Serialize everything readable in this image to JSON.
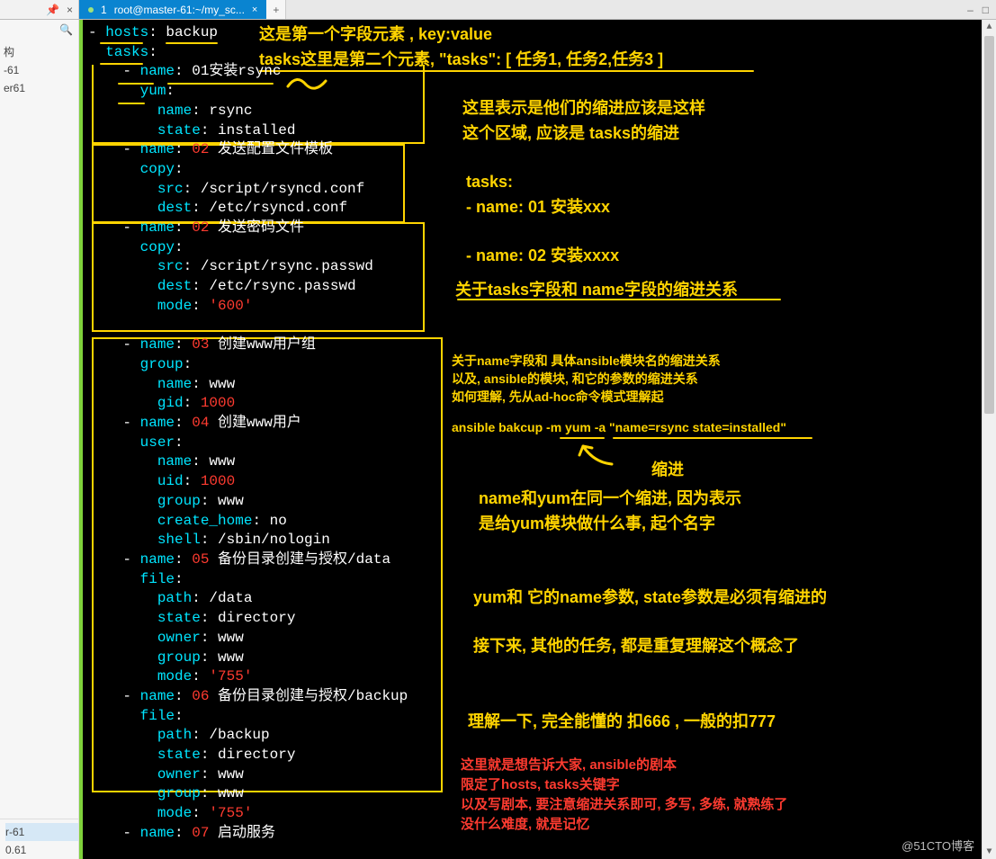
{
  "tabbar": {
    "pin_icon": "📌",
    "close_left_icon": "×",
    "active_tab_prefix": "1",
    "active_tab_title": "root@master-61:~/my_sc...",
    "add_tab": "+",
    "min": "–",
    "max": "□"
  },
  "sidebar": {
    "search_icon": "🔍",
    "tree": [
      "构",
      "-61",
      "er61"
    ],
    "bottom": [
      "r-61",
      "0.61"
    ]
  },
  "code": {
    "l1": {
      "dash": "- ",
      "k1": "hosts",
      "v1": "backup"
    },
    "l2": {
      "sp": "  ",
      "k1": "tasks"
    },
    "l3": {
      "sp": "    ",
      "dash": "- ",
      "k1": "name",
      "v1": "01安装rsync"
    },
    "l4": {
      "sp": "      ",
      "k1": "yum"
    },
    "l5": {
      "sp": "        ",
      "k1": "name",
      "v1": "rsync"
    },
    "l6": {
      "sp": "        ",
      "k1": "state",
      "v1": "installed"
    },
    "l7": {
      "sp": "    ",
      "dash": "- ",
      "k1": "name",
      "r": "02",
      "v1": "发送配置文件模板"
    },
    "l8": {
      "sp": "      ",
      "k1": "copy"
    },
    "l9": {
      "sp": "        ",
      "k1": "src",
      "v1": "/script/rsyncd.conf"
    },
    "l10": {
      "sp": "        ",
      "k1": "dest",
      "v1": "/etc/rsyncd.conf"
    },
    "l11": {
      "sp": "    ",
      "dash": "- ",
      "k1": "name",
      "r": "02",
      "v1": "发送密码文件"
    },
    "l12": {
      "sp": "      ",
      "k1": "copy"
    },
    "l13": {
      "sp": "        ",
      "k1": "src",
      "v1": "/script/rsync.passwd"
    },
    "l14": {
      "sp": "        ",
      "k1": "dest",
      "v1": "/etc/rsync.passwd"
    },
    "l15": {
      "sp": "        ",
      "k1": "mode",
      "r": "'600'"
    },
    "l17": {
      "sp": "    ",
      "dash": "- ",
      "k1": "name",
      "r": "03",
      "v1": "创建www用户组"
    },
    "l18": {
      "sp": "      ",
      "k1": "group"
    },
    "l19": {
      "sp": "        ",
      "k1": "name",
      "v1": "www"
    },
    "l20": {
      "sp": "        ",
      "k1": "gid",
      "r": "1000"
    },
    "l21": {
      "sp": "    ",
      "dash": "- ",
      "k1": "name",
      "r": "04",
      "v1": "创建www用户"
    },
    "l22": {
      "sp": "      ",
      "k1": "user"
    },
    "l23": {
      "sp": "        ",
      "k1": "name",
      "v1": "www"
    },
    "l24": {
      "sp": "        ",
      "k1": "uid",
      "r": "1000"
    },
    "l25": {
      "sp": "        ",
      "k1": "group",
      "v1": "www"
    },
    "l26": {
      "sp": "        ",
      "k1": "create_home",
      "v1": "no"
    },
    "l27": {
      "sp": "        ",
      "k1": "shell",
      "v1": "/sbin/nologin"
    },
    "l28": {
      "sp": "    ",
      "dash": "- ",
      "k1": "name",
      "r": "05",
      "v1": "备份目录创建与授权/data"
    },
    "l29": {
      "sp": "      ",
      "k1": "file"
    },
    "l30": {
      "sp": "        ",
      "k1": "path",
      "v1": "/data"
    },
    "l31": {
      "sp": "        ",
      "k1": "state",
      "v1": "directory"
    },
    "l32": {
      "sp": "        ",
      "k1": "owner",
      "v1": "www"
    },
    "l33": {
      "sp": "        ",
      "k1": "group",
      "v1": "www"
    },
    "l34": {
      "sp": "        ",
      "k1": "mode",
      "r": "'755'"
    },
    "l35": {
      "sp": "    ",
      "dash": "- ",
      "k1": "name",
      "r": "06",
      "v1": "备份目录创建与授权/backup"
    },
    "l36": {
      "sp": "      ",
      "k1": "file"
    },
    "l37": {
      "sp": "        ",
      "k1": "path",
      "v1": "/backup"
    },
    "l38": {
      "sp": "        ",
      "k1": "state",
      "v1": "directory"
    },
    "l39": {
      "sp": "        ",
      "k1": "owner",
      "v1": "www"
    },
    "l40": {
      "sp": "        ",
      "k1": "group",
      "v1": "www"
    },
    "l41": {
      "sp": "        ",
      "k1": "mode",
      "r": "'755'"
    },
    "l42": {
      "sp": "    ",
      "dash": "- ",
      "k1": "name",
      "r": "07",
      "v1": "启动服务"
    }
  },
  "ann": {
    "a1": "这是第一个字段元素  ,   key:value",
    "a2": "tasks这里是第二个元素,   \"tasks\":   [    任务1,  任务2,任务3    ]",
    "a3a": "这里表示是他们的缩进应该是这样",
    "a3b": "这个区域,  应该是 tasks的缩进",
    "a4": "tasks:",
    "a5": "    - name: 01 安装xxx",
    "a6": "    - name:  02 安装xxxx",
    "a7": "关于tasks字段和 name字段的缩进关系",
    "a8a": "关于name字段和 具体ansible模块名的缩进关系",
    "a8b": "以及,  ansible的模块,  和它的参数的缩进关系",
    "a8c": "如何理解,  先从ad-hoc命令模式理解起",
    "a9": "ansible bakcup -m yum -a \"name=rsync  state=installed\"",
    "a10": "缩进",
    "a11a": "name和yum在同一个缩进,  因为表示",
    "a11b": "是给yum模块做什么事,  起个名字",
    "a12": "yum和 它的name参数,  state参数是必须有缩进的",
    "a13": "接下来,  其他的任务,  都是重复理解这个概念了",
    "a14": "理解一下,  完全能懂的 扣666 ,  一般的扣777",
    "r1": "这里就是想告诉大家,  ansible的剧本",
    "r2": "限定了hosts,  tasks关键字",
    "r3": "以及写剧本,  要注意缩进关系即可,  多写,  多练,  就熟练了",
    "r4": "没什么难度,  就是记忆"
  },
  "watermark": "@51CTO博客"
}
